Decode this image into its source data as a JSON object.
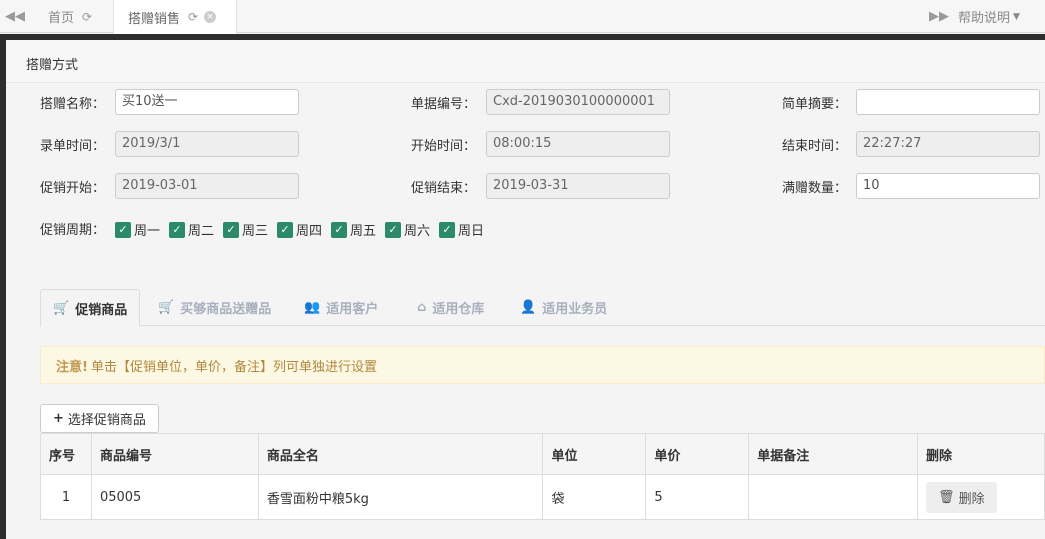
{
  "tabbar": {
    "home_label": "首页",
    "active_label": "搭赠销售",
    "help_label": "帮助说明"
  },
  "panel": {
    "title": "搭赠方式"
  },
  "form": {
    "name_label": "搭赠名称：",
    "name_value": "买10送一",
    "bill_no_label": "单据编号：",
    "bill_no_value": "Cxd-2019030100000001",
    "summary_label": "简单摘要：",
    "summary_value": "",
    "entry_time_label": "录单时间：",
    "entry_time_value": "2019/3/1",
    "start_time_label": "开始时间：",
    "start_time_value": "08:00:15",
    "end_time_label": "结束时间：",
    "end_time_value": "22:27:27",
    "promo_start_label": "促销开始：",
    "promo_start_value": "2019-03-01",
    "promo_end_label": "促销结束：",
    "promo_end_value": "2019-03-31",
    "gift_qty_label": "满赠数量：",
    "gift_qty_value": "10",
    "cycle_label": "促销周期：",
    "weekdays": [
      "周一",
      "周二",
      "周三",
      "周四",
      "周五",
      "周六",
      "周日"
    ]
  },
  "subtabs": [
    "促销商品",
    "买够商品送赠品",
    "适用客户",
    "适用仓库",
    "适用业务员"
  ],
  "alert": {
    "strong": "注意!",
    "text": "单击【促销单位，单价，备注】列可单独进行设置"
  },
  "select_button": "选择促销商品",
  "table": {
    "headers": [
      "序号",
      "商品编号",
      "商品全名",
      "单位",
      "单价",
      "单据备注",
      "删除"
    ],
    "rows": [
      {
        "no": "1",
        "code": "05005",
        "name": "香雪面粉中粮5kg",
        "unit": "袋",
        "price": "5",
        "note": "",
        "delete": "删除"
      }
    ]
  }
}
